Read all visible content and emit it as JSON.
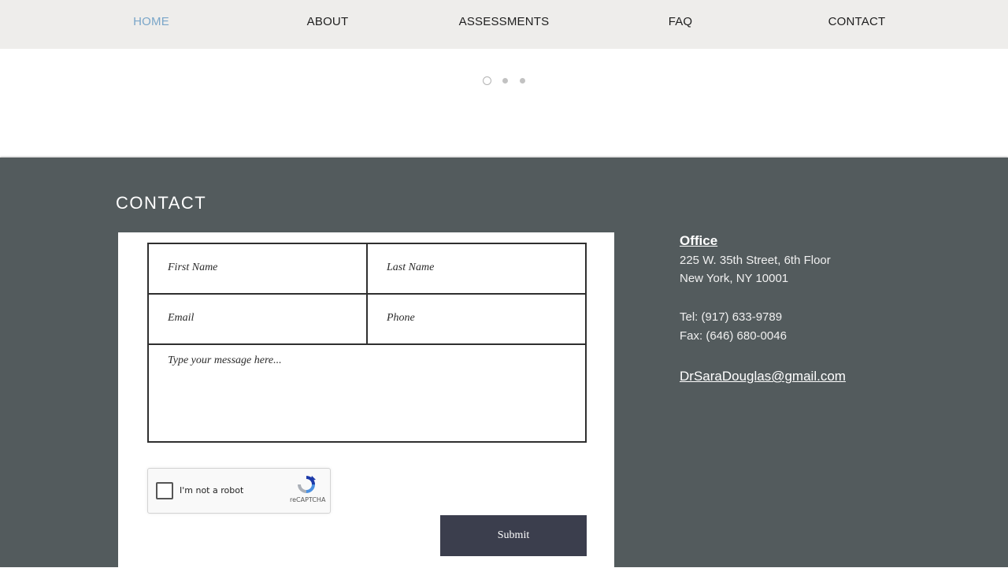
{
  "nav": {
    "items": [
      {
        "label": "HOME",
        "active": true
      },
      {
        "label": "ABOUT",
        "active": false
      },
      {
        "label": "ASSESSMENTS",
        "active": false
      },
      {
        "label": "FAQ",
        "active": false
      },
      {
        "label": "CONTACT",
        "active": false
      }
    ]
  },
  "slideshow": {
    "dot_count": 3,
    "active_index": 0
  },
  "contact": {
    "title": "CONTACT",
    "form": {
      "first_name_placeholder": "First Name",
      "last_name_placeholder": "Last Name",
      "email_placeholder": "Email",
      "phone_placeholder": "Phone",
      "message_placeholder": "Type your message here...",
      "recaptcha_label": "I'm not a robot",
      "recaptcha_brand": "reCAPTCHA",
      "submit_label": "Submit"
    },
    "info": {
      "office_label": "Office",
      "address_line1": "225 W. 35th Street, 6th Floor",
      "address_line2": "New York, NY 10001",
      "tel": "Tel: (917) 633-9789",
      "fax": "Fax: (646) 680-0046",
      "email": "DrSaraDouglas@gmail.com"
    }
  },
  "colors": {
    "nav_bg": "#eeedeb",
    "nav_active": "#7aa6c9",
    "section_bg": "#535b5d",
    "submit_bg": "#3b3e4d"
  }
}
